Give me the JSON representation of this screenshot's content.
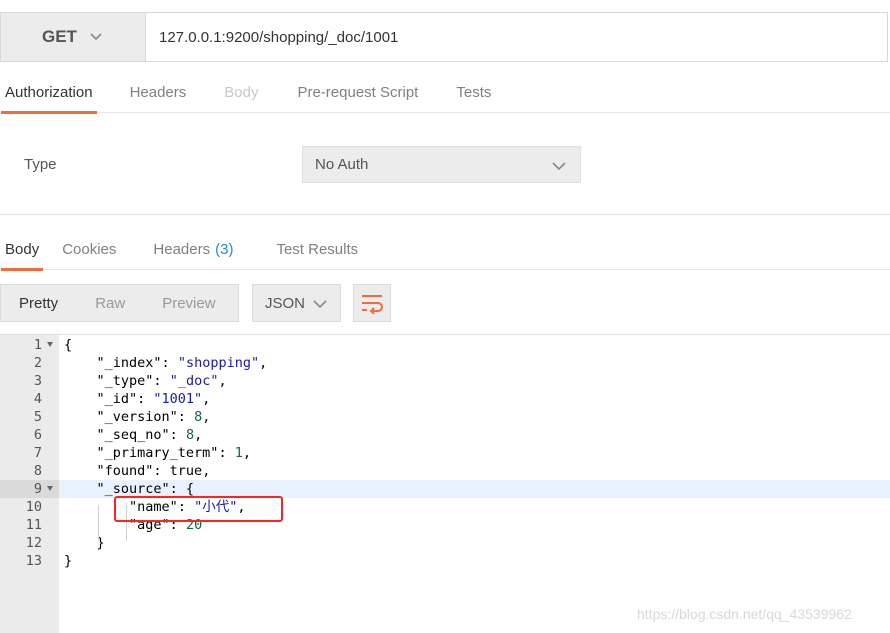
{
  "request": {
    "method": "GET",
    "url": "127.0.0.1:9200/shopping/_doc/1001"
  },
  "request_tabs": [
    {
      "label": "Authorization"
    },
    {
      "label": "Headers"
    },
    {
      "label": "Body"
    },
    {
      "label": "Pre-request Script"
    },
    {
      "label": "Tests"
    }
  ],
  "auth": {
    "type_label": "Type",
    "type_value": "No Auth"
  },
  "response_tabs": [
    {
      "label": "Body"
    },
    {
      "label": "Cookies"
    },
    {
      "label": "Headers",
      "count": "(3)"
    },
    {
      "label": "Test Results"
    }
  ],
  "format_buttons": [
    {
      "label": "Pretty"
    },
    {
      "label": "Raw"
    },
    {
      "label": "Preview"
    }
  ],
  "language": "JSON",
  "code_lines": [
    {
      "n": "1",
      "t": "{"
    },
    {
      "n": "2",
      "t": "    \"_index\": \"shopping\","
    },
    {
      "n": "3",
      "t": "    \"_type\": \"_doc\","
    },
    {
      "n": "4",
      "t": "    \"_id\": \"1001\","
    },
    {
      "n": "5",
      "t": "    \"_version\": 8,"
    },
    {
      "n": "6",
      "t": "    \"_seq_no\": 8,"
    },
    {
      "n": "7",
      "t": "    \"_primary_term\": 1,"
    },
    {
      "n": "8",
      "t": "    \"found\": true,"
    },
    {
      "n": "9",
      "t": "    \"_source\": {"
    },
    {
      "n": "10",
      "t": "        \"name\": \"小代\","
    },
    {
      "n": "11",
      "t": "        \"age\": 20"
    },
    {
      "n": "12",
      "t": "    }"
    },
    {
      "n": "13",
      "t": "}"
    }
  ],
  "watermark": "https://blog.csdn.net/qq_43539962"
}
